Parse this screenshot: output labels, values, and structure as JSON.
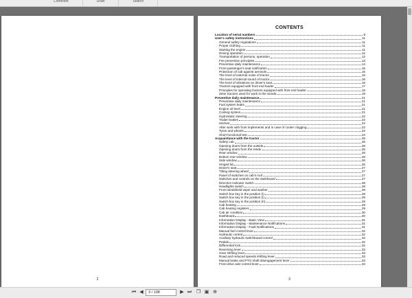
{
  "toolbar": {
    "items": [
      "Comment",
      "Draw",
      "Search"
    ]
  },
  "viewer": {
    "left_page_number": "2",
    "right_page_number": "3",
    "page_indicator": "3 / 108"
  },
  "contents": {
    "title": "CONTENTS",
    "entries": [
      {
        "t": "Location of serial numbers",
        "p": "9",
        "section": true
      },
      {
        "t": "User's safety instructions",
        "p": "11",
        "section": true
      },
      {
        "t": "General safety regulations",
        "p": "11"
      },
      {
        "t": "Proper clothing",
        "p": "11"
      },
      {
        "t": "Starting the engine",
        "p": "11"
      },
      {
        "t": "Driving operation",
        "p": "12"
      },
      {
        "t": "Transportation of persons, operation",
        "p": "12"
      },
      {
        "t": "Fire prevention principles",
        "p": "13"
      },
      {
        "t": "Preventive daily maintenance",
        "p": "14"
      },
      {
        "t": "Front passenger's seat notification",
        "p": "15"
      },
      {
        "t": "Protection of cab against aerosols",
        "p": "15"
      },
      {
        "t": "The level of external noise of tractor",
        "p": "16"
      },
      {
        "t": "The level of internal sound of tractor",
        "p": "16"
      },
      {
        "t": "The level of vibrations on driver's seat",
        "p": "16"
      },
      {
        "t": "Tractors equipped with front end loader",
        "p": "17"
      },
      {
        "t": "Principles for operating tractors equipped with front end loader",
        "p": "18"
      },
      {
        "t": "Zetor tractors used for work in the woods",
        "p": "19"
      },
      {
        "t": "Preventive daily maintenance",
        "p": "21",
        "section": true
      },
      {
        "t": "Preventive daily maintenance",
        "p": "21"
      },
      {
        "t": "Fuel system leaks",
        "p": "21"
      },
      {
        "t": "Engine oil level",
        "p": "21"
      },
      {
        "t": "Cooling system",
        "p": "21"
      },
      {
        "t": "Hydrostatic steering",
        "p": "22"
      },
      {
        "t": "Trailer brakes",
        "p": "22"
      },
      {
        "t": "Hitches",
        "p": "22"
      },
      {
        "t": "After work with front implements and in case of cooler clogging",
        "p": "22"
      },
      {
        "t": "Tyres and wheels",
        "p": "22"
      },
      {
        "t": "Short functional test",
        "p": "23"
      },
      {
        "t": "Acquaintance with the tractor",
        "p": "25",
        "section": true
      },
      {
        "t": "Safety cab",
        "p": "26"
      },
      {
        "t": "Opening doors from the outside",
        "p": "26"
      },
      {
        "t": "Opening doors from the inside",
        "p": "26"
      },
      {
        "t": "Rear window",
        "p": "26"
      },
      {
        "t": "Bottom rear window",
        "p": "26"
      },
      {
        "t": "Side window",
        "p": "26"
      },
      {
        "t": "Hinged lid",
        "p": "26"
      },
      {
        "t": "Driver's seat",
        "p": "27"
      },
      {
        "t": "Tilting steering wheel",
        "p": "27"
      },
      {
        "t": "Panel of switches on cab's roof",
        "p": "27"
      },
      {
        "t": "Switches and controls on the dashboard",
        "p": "27"
      },
      {
        "t": "Direction indicator switch",
        "p": "28"
      },
      {
        "t": "Headlights switch",
        "p": "28"
      },
      {
        "t": "Front windshield wiper and washer",
        "p": "28"
      },
      {
        "t": "Switch box key in the position (I)",
        "p": "28"
      },
      {
        "t": "Switch box key in the position (I)",
        "p": "29"
      },
      {
        "t": "Switch box key in the position (II)",
        "p": "29"
      },
      {
        "t": "Cab heating",
        "p": "29"
      },
      {
        "t": "Cab heating registers",
        "p": "29"
      },
      {
        "t": "Cab air condition",
        "p": "30"
      },
      {
        "t": "Dashboard",
        "p": "30"
      },
      {
        "t": "Information Display - Basic View",
        "p": "31"
      },
      {
        "t": "Information Display - Maintenance Notifications",
        "p": "31"
      },
      {
        "t": "Information Display - Fault Notifications",
        "p": "31"
      },
      {
        "t": "Manual fuel control lever",
        "p": "32"
      },
      {
        "t": "Hydraulic control",
        "p": "32"
      },
      {
        "t": "Auxiliary hydraulic switchboard control",
        "p": "32"
      },
      {
        "t": "Pedals",
        "p": "32"
      },
      {
        "t": "Differential lock",
        "p": "32"
      },
      {
        "t": "Reversing lever",
        "p": "33"
      },
      {
        "t": "Gear shifting lever",
        "p": "33"
      },
      {
        "t": "Road and reduced speeds shifting lever",
        "p": "33"
      },
      {
        "t": "Manual brake and PTO shaft disengagement lever",
        "p": "33"
      },
      {
        "t": "Front drive axle control lever",
        "p": "34"
      }
    ]
  },
  "icons": {
    "first": "first-page-icon",
    "prev": "prev-page-icon",
    "next": "next-page-icon",
    "last": "last-page-icon",
    "copy": "copy-icon",
    "layout": "page-layout-icon",
    "zoom": "zoom-icon"
  }
}
